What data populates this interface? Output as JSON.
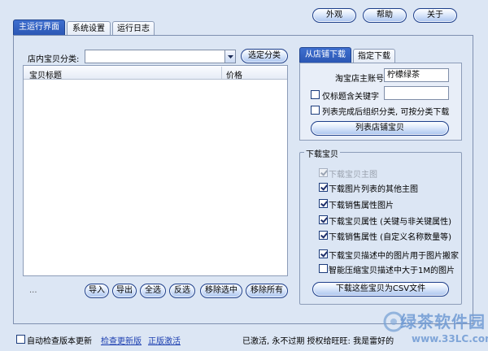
{
  "top_buttons": {
    "appearance": "外观",
    "help": "帮助",
    "about": "关于"
  },
  "main_tabs": [
    {
      "label": "主运行界面",
      "active": true
    },
    {
      "label": "系统设置",
      "active": false
    },
    {
      "label": "运行日志",
      "active": false
    }
  ],
  "left": {
    "category_label": "店内宝贝分类:",
    "category_value": "",
    "select_category_button": "选定分类",
    "table": {
      "columns": [
        "宝贝标题",
        "价格"
      ],
      "rows": []
    },
    "ellipsis": "...",
    "actions": [
      "导入",
      "导出",
      "全选",
      "反选",
      "移除选中",
      "移除所有"
    ]
  },
  "right": {
    "tabs": [
      {
        "label": "从店铺下载",
        "active": true
      },
      {
        "label": "指定下载",
        "active": false
      }
    ],
    "shop_account_label": "淘宝店主账号",
    "shop_account_value": "柠檬绿茶",
    "keyword_checkbox": {
      "label": "仅标题含关键字",
      "checked": false
    },
    "keyword_value": "",
    "group_checkbox": {
      "label": "列表完成后组织分类, 可按分类下载",
      "checked": false
    },
    "list_button": "列表店铺宝贝",
    "download_group": {
      "title": "下载宝贝",
      "options": [
        {
          "label": "下载宝贝主图",
          "checked": true,
          "disabled": true
        },
        {
          "label": "下载图片列表的其他主图",
          "checked": true,
          "disabled": false
        },
        {
          "label": "下载销售属性图片",
          "checked": true,
          "disabled": false
        },
        {
          "label": "下载宝贝属性 (关键与非关键属性)",
          "checked": true,
          "disabled": false
        },
        {
          "label": "下载销售属性 (自定义名称数量等)",
          "checked": true,
          "disabled": false
        },
        {
          "label": "下载宝贝描述中的图片用于图片搬家",
          "checked": true,
          "disabled": false
        },
        {
          "label": "智能压缩宝贝描述中大于1M的图片",
          "checked": false,
          "disabled": false
        }
      ],
      "download_csv_button": "下载这些宝贝为CSV文件"
    }
  },
  "footer": {
    "auto_check_label": "自动检查版本更新",
    "auto_check_checked": false,
    "check_update_link": "检查更新版",
    "activate_link": "正版激活",
    "status_text": "已激活, 永不过期 授权给旺旺: 我是雷好的"
  },
  "watermark": {
    "text": "绿茶软件园",
    "url": "www.33LC.com"
  },
  "colors": {
    "background": "#dce6f4",
    "tab_active": "#2a56b3",
    "button_border": "#1e3f8a",
    "link": "#1c3fb0"
  }
}
